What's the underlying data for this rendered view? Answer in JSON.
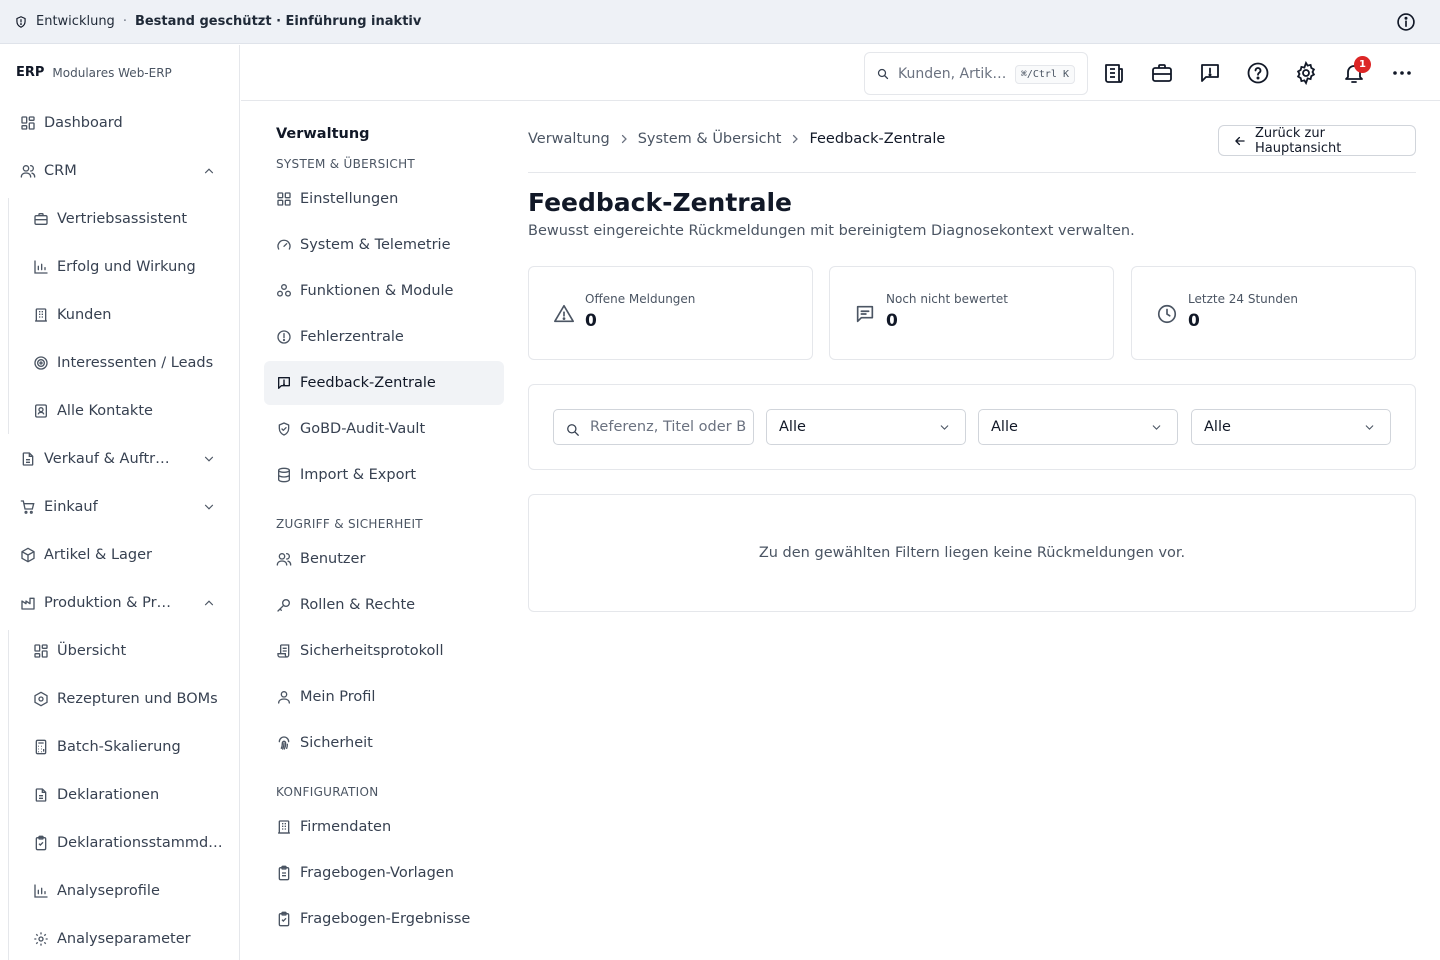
{
  "banner": {
    "env": "Entwicklung",
    "separator": "·",
    "status": "Bestand geschützt · Einführung inaktiv"
  },
  "brand": {
    "name": "ERP",
    "subtitle": "Modulares Web-ERP"
  },
  "sidebar": {
    "items": [
      {
        "label": "Dashboard",
        "icon": "dashboard-icon"
      },
      {
        "label": "CRM",
        "icon": "users-icon",
        "expanded": true
      },
      {
        "label": "Vertriebsassistent",
        "icon": "briefcase-icon"
      },
      {
        "label": "Erfolg und Wirkung",
        "icon": "bar-chart-icon"
      },
      {
        "label": "Kunden",
        "icon": "building-icon"
      },
      {
        "label": "Interessenten / Leads",
        "icon": "target-icon"
      },
      {
        "label": "Alle Kontakte",
        "icon": "contact-icon"
      },
      {
        "label": "Verkauf & Auftr…",
        "icon": "document-icon",
        "expanded": false
      },
      {
        "label": "Einkauf",
        "icon": "cart-icon",
        "expanded": false
      },
      {
        "label": "Artikel & Lager",
        "icon": "package-icon"
      },
      {
        "label": "Produktion & Pr…",
        "icon": "factory-icon",
        "expanded": true
      },
      {
        "label": "Übersicht",
        "icon": "dashboard-icon"
      },
      {
        "label": "Rezepturen und BOMs",
        "icon": "recipe-icon"
      },
      {
        "label": "Batch-Skalierung",
        "icon": "calculator-icon"
      },
      {
        "label": "Deklarationen",
        "icon": "document-icon"
      },
      {
        "label": "Deklarationsstammd…",
        "icon": "clipboard-icon"
      },
      {
        "label": "Analyseprofile",
        "icon": "bar-chart-icon"
      },
      {
        "label": "Analyseparameter",
        "icon": "gear-icon"
      }
    ]
  },
  "header": {
    "search_placeholder": "Kunden, Artik…",
    "shortcut": "⌘/Ctrl K",
    "notification_count": "1"
  },
  "admin_nav": {
    "title": "Verwaltung",
    "sections": [
      {
        "label": "SYSTEM & ÜBERSICHT",
        "items": [
          {
            "label": "Einstellungen",
            "icon": "dashboard-icon"
          },
          {
            "label": "System & Telemetrie",
            "icon": "gauge-icon"
          },
          {
            "label": "Funktionen & Module",
            "icon": "modules-icon"
          },
          {
            "label": "Fehlerzentrale",
            "icon": "alert-circle-icon"
          },
          {
            "label": "Feedback-Zentrale",
            "icon": "feedback-icon",
            "active": true
          },
          {
            "label": "GoBD-Audit-Vault",
            "icon": "shield-check-icon"
          },
          {
            "label": "Import & Export",
            "icon": "database-icon"
          }
        ]
      },
      {
        "label": "ZUGRIFF & SICHERHEIT",
        "items": [
          {
            "label": "Benutzer",
            "icon": "users-icon"
          },
          {
            "label": "Rollen & Rechte",
            "icon": "key-icon"
          },
          {
            "label": "Sicherheitsprotokoll",
            "icon": "scroll-icon"
          },
          {
            "label": "Mein Profil",
            "icon": "user-icon"
          },
          {
            "label": "Sicherheit",
            "icon": "fingerprint-icon"
          }
        ]
      },
      {
        "label": "KONFIGURATION",
        "items": [
          {
            "label": "Firmendaten",
            "icon": "building-icon"
          },
          {
            "label": "Fragebogen-Vorlagen",
            "icon": "clipboard-icon"
          },
          {
            "label": "Fragebogen-Ergebnisse",
            "icon": "clipboard-check-icon"
          }
        ]
      }
    ]
  },
  "main": {
    "breadcrumb": [
      "Verwaltung",
      "System & Übersicht",
      "Feedback-Zentrale"
    ],
    "back_button": "Zurück zur Hauptansicht",
    "title": "Feedback-Zentrale",
    "description": "Bewusst eingereichte Rückmeldungen mit bereinigtem Diagnosekontext verwalten.",
    "stats": [
      {
        "label": "Offene Meldungen",
        "value": "0",
        "icon": "warning-icon"
      },
      {
        "label": "Noch nicht bewertet",
        "value": "0",
        "icon": "message-icon"
      },
      {
        "label": "Letzte 24 Stunden",
        "value": "0",
        "icon": "clock-icon"
      }
    ],
    "filters": {
      "search_placeholder": "Referenz, Titel oder B",
      "selects": [
        "Alle",
        "Alle",
        "Alle"
      ]
    },
    "empty_message": "Zu den gewählten Filtern liegen keine Rückmeldungen vor."
  }
}
